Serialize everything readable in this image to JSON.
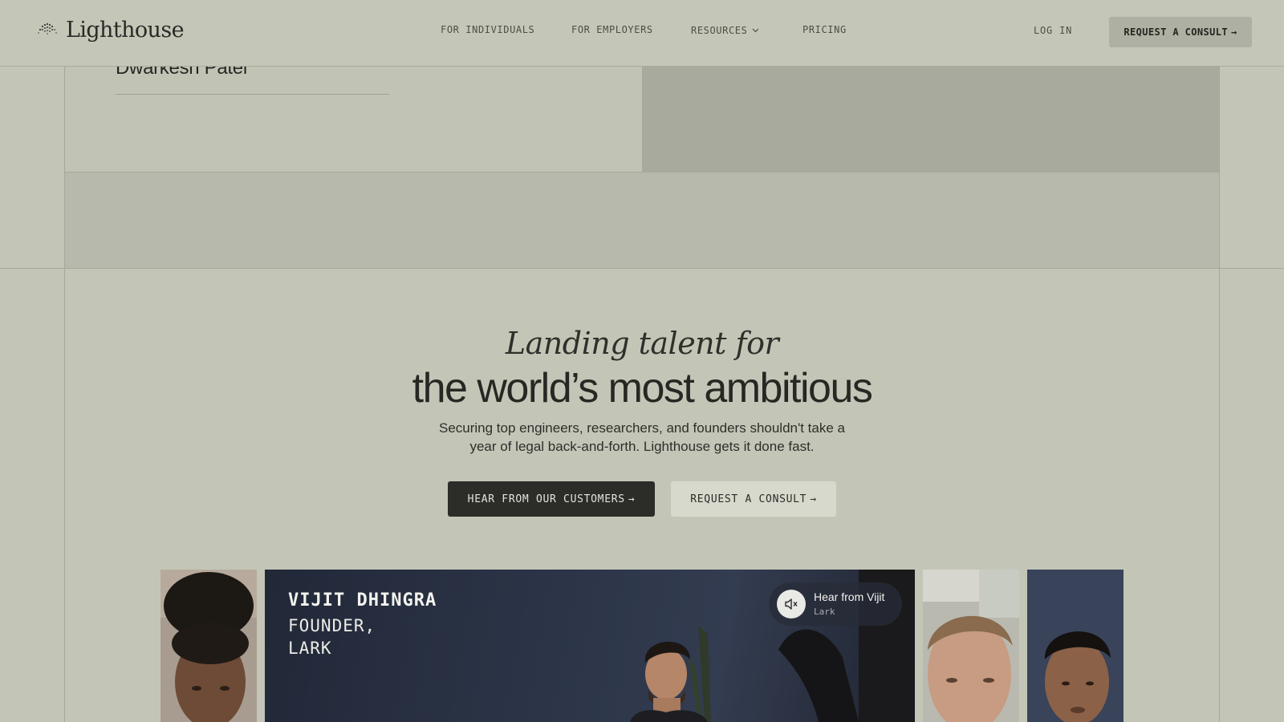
{
  "header": {
    "logo_text": "Lighthouse",
    "nav": [
      {
        "label": "FOR INDIVIDUALS"
      },
      {
        "label": "FOR EMPLOYERS"
      },
      {
        "label": "RESOURCES",
        "has_dropdown": true
      },
      {
        "label": "PRICING"
      }
    ],
    "login_label": "LOG IN",
    "cta_label": "REQUEST A CONSULT",
    "arrow": "→",
    "dropdown_icon": "chevron-down-icon"
  },
  "upper": {
    "person_name": "Dwarkesh Patel"
  },
  "hero": {
    "italic_line": "Landing talent for",
    "title": "the world’s most ambitious",
    "subtitle": "Securing top engineers, researchers, and founders shouldn't take a year of legal back-and-forth. Lighthouse gets it done fast.",
    "primary_button": "HEAR FROM OUR CUSTOMERS",
    "secondary_button": "REQUEST A CONSULT",
    "arrow": "→"
  },
  "video": {
    "name": "VIJIT DHINGRA",
    "role_line1": "FOUNDER,",
    "role_line2": "LARK",
    "pill_title": "Hear from Vijit",
    "pill_subtitle": "Lark",
    "mute_icon": "speaker-muted-icon"
  },
  "colors": {
    "background": "#c3c6b7",
    "dark_button": "#2c2c29",
    "light_button": "#d8d9cd",
    "header_cta": "#adb0a3"
  }
}
